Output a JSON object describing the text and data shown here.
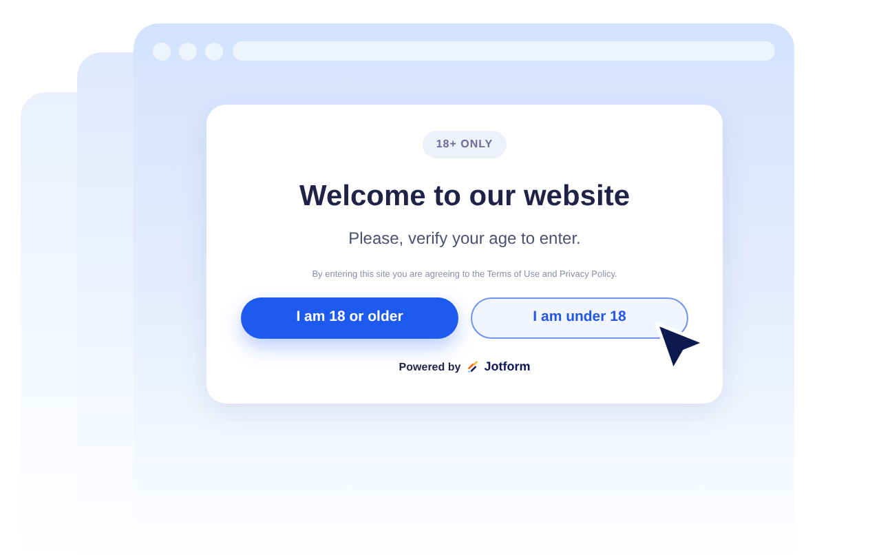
{
  "modal": {
    "badge": "18+ ONLY",
    "title": "Welcome to our website",
    "subtitle": "Please, verify your age to enter.",
    "notice": "By entering this site you are agreeing to the Terms of Use and Privacy Policy.",
    "buttons": [
      {
        "label": "I am 18 or older",
        "kind": "primary"
      },
      {
        "label": "I am under 18",
        "kind": "secondary"
      }
    ],
    "powered_by": {
      "prefix": "Powered by",
      "brand": "Jotform"
    }
  }
}
